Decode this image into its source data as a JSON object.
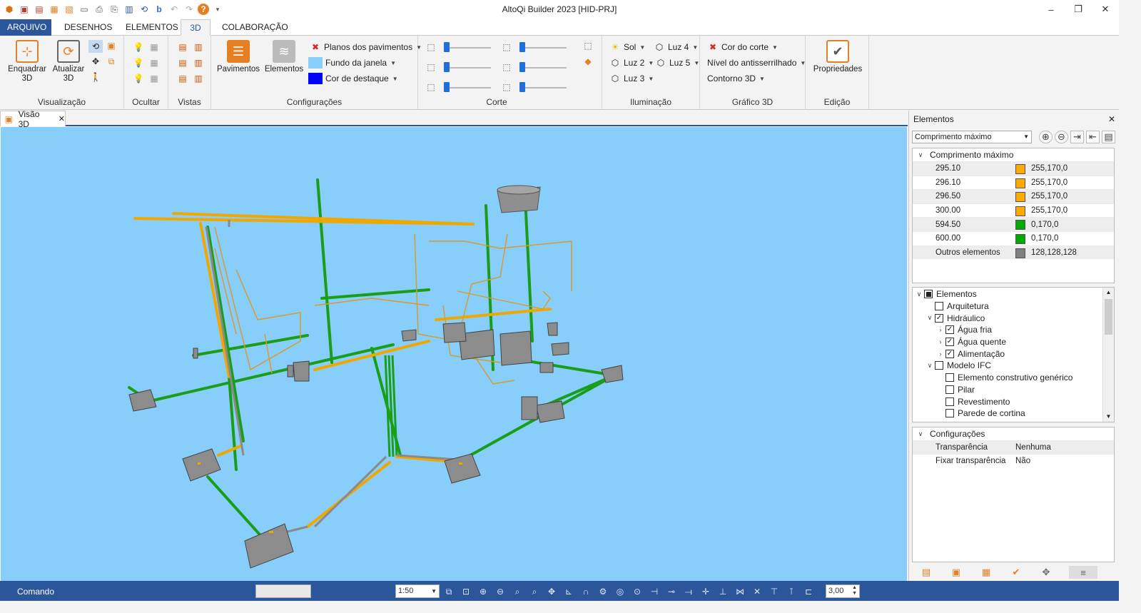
{
  "window": {
    "title": "AltoQi Builder 2023 [HID-PRJ]",
    "minimize": "–",
    "restore": "❐",
    "close": "✕"
  },
  "qat": [
    "app-logo",
    "open",
    "new",
    "save",
    "save-as",
    "export",
    "print",
    "print-preview",
    "report",
    "refresh",
    "builder-b",
    "undo",
    "redo",
    "help",
    "more"
  ],
  "ribbon_tabs": [
    {
      "label": "ARQUIVO",
      "state": "file"
    },
    {
      "label": "DESENHOS",
      "state": ""
    },
    {
      "label": "ELEMENTOS",
      "state": ""
    },
    {
      "label": "3D",
      "state": "active"
    },
    {
      "label": "COLABORAÇÃO",
      "state": ""
    }
  ],
  "ribbon": {
    "visualizacao": {
      "title": "Visualização",
      "enquadrar": "Enquadrar\n3D",
      "atualizar": "Atualizar\n3D"
    },
    "ocultar": {
      "title": "Ocultar"
    },
    "vistas": {
      "title": "Vistas"
    },
    "configuracoes": {
      "title": "Configurações",
      "pavimentos": "Pavimentos",
      "elementos": "Elementos",
      "planos": "Planos dos pavimentos",
      "fundo": "Fundo da janela",
      "destaque": "Cor de destaque",
      "fundo_color": "#87cefa",
      "destaque_color": "#0000ff"
    },
    "corte": {
      "title": "Corte"
    },
    "iluminacao": {
      "title": "Iluminação",
      "sol": "Sol",
      "luz2": "Luz 2",
      "luz3": "Luz 3",
      "luz4": "Luz 4",
      "luz5": "Luz 5"
    },
    "grafico3d": {
      "title": "Gráfico 3D",
      "cor_corte": "Cor do corte",
      "antisserrilhado": "Nível do antisserrilhado",
      "contorno": "Contorno 3D"
    },
    "edicao": {
      "title": "Edição",
      "propriedades": "Propriedades"
    }
  },
  "document_tab": {
    "label": "Visão 3D",
    "close": "✕"
  },
  "panel": {
    "title": "Elementos",
    "close": "✕",
    "filter_value": "Comprimento máximo",
    "legend_title": "Comprimento máximo",
    "legend": [
      {
        "value": "295.10",
        "rgb": "255,170,0",
        "color": "#ffaa00"
      },
      {
        "value": "296.10",
        "rgb": "255,170,0",
        "color": "#ffaa00"
      },
      {
        "value": "296.50",
        "rgb": "255,170,0",
        "color": "#ffaa00"
      },
      {
        "value": "300.00",
        "rgb": "255,170,0",
        "color": "#ffaa00"
      },
      {
        "value": "594.50",
        "rgb": "0,170,0",
        "color": "#00aa00"
      },
      {
        "value": "600.00",
        "rgb": "0,170,0",
        "color": "#00aa00"
      },
      {
        "value": "Outros elementos",
        "rgb": "128,128,128",
        "color": "#808080"
      }
    ],
    "tree": [
      {
        "label": "Elementos",
        "level": 0,
        "chev": "v",
        "cb": "partial"
      },
      {
        "label": "Arquitetura",
        "level": 1,
        "chev": "",
        "cb": ""
      },
      {
        "label": "Hidráulico",
        "level": 1,
        "chev": "v",
        "cb": "checked"
      },
      {
        "label": "Água fria",
        "level": 2,
        "chev": ">",
        "cb": "checked"
      },
      {
        "label": "Água quente",
        "level": 2,
        "chev": ">",
        "cb": "checked"
      },
      {
        "label": "Alimentação",
        "level": 2,
        "chev": ">",
        "cb": "checked"
      },
      {
        "label": "Modelo IFC",
        "level": 1,
        "chev": "v",
        "cb": ""
      },
      {
        "label": "Elemento construtivo genérico",
        "level": 2,
        "chev": "",
        "cb": ""
      },
      {
        "label": "Pilar",
        "level": 2,
        "chev": "",
        "cb": ""
      },
      {
        "label": "Revestimento",
        "level": 2,
        "chev": "",
        "cb": ""
      },
      {
        "label": "Parede de cortina",
        "level": 2,
        "chev": "",
        "cb": ""
      }
    ],
    "config_title": "Configurações",
    "config": [
      {
        "key": "Transparência",
        "value": "Nenhuma"
      },
      {
        "key": "Fixar transparência",
        "value": "Não"
      }
    ]
  },
  "status": {
    "command_label": "Comando",
    "scale": "1:50",
    "line_width": "3,00"
  }
}
